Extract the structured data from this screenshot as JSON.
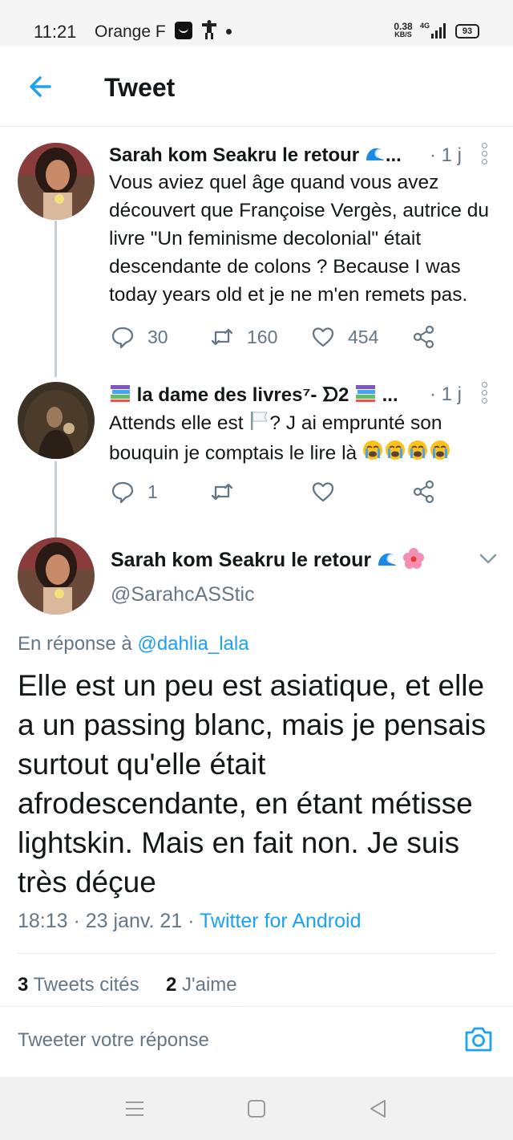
{
  "status_bar": {
    "time": "11:21",
    "carrier": "Orange F",
    "speed_value": "0.38",
    "speed_unit": "KB/S",
    "network": "4G",
    "battery": "93"
  },
  "header": {
    "title": "Tweet"
  },
  "thread": [
    {
      "name": "Sarah kom Seakru le retour",
      "time": "· 1 j",
      "text": "Vous aviez quel âge quand vous avez découvert que Françoise Vergès, autrice du livre \"Un feminisme decolonial\" était descendante de colons ? Because I was today years old et je ne m'en remets pas.",
      "replies": "30",
      "retweets": "160",
      "likes": "454"
    },
    {
      "name": "la dame des livres⁷- ᗤ2",
      "time": "· 1 j",
      "text_before": "Attends elle est",
      "text_after": "? J ai emprunté son bouquin je comptais le lire là",
      "replies": "1"
    }
  ],
  "main_tweet": {
    "name": "Sarah kom Seakru le retour",
    "handle": "@SarahcASStic",
    "reply_prefix": "En réponse à",
    "reply_handle": "@dahlia_lala",
    "text": "Elle est un peu est asiatique, et elle a un passing blanc, mais je pensais surtout qu'elle était afrodescendante, en étant métisse lightskin. Mais en fait non. Je suis très déçue",
    "date": "18:13 · 23 janv. 21 ·",
    "source": "Twitter for Android",
    "quote_count": "3",
    "quote_label": "Tweets cités",
    "like_count": "2",
    "like_label": "J'aime"
  },
  "reply_bar": {
    "placeholder": "Tweeter votre réponse"
  },
  "colors": {
    "accent": "#1da1f2",
    "text_primary": "#14171a",
    "text_secondary": "#657786",
    "divider": "#e6ecf0"
  }
}
